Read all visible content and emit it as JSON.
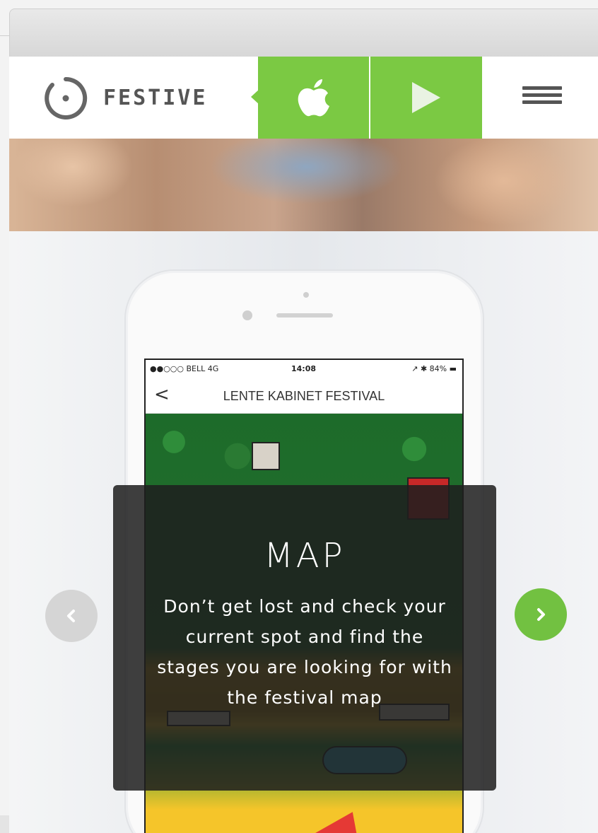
{
  "header": {
    "brand": "FESTIVE",
    "app_store_label": "apple-logo",
    "play_store_label": "play-triangle",
    "menu_icon": "hamburger-menu-icon"
  },
  "phone": {
    "status": {
      "carrier": "●●○○○ BELL  4G",
      "time": "14:08",
      "indicators": "↗ ✱ 84% ▬"
    },
    "nav": {
      "back": "<",
      "title": "LENTE KABINET FESTIVAL"
    }
  },
  "slide": {
    "title": "MAP",
    "description": "Don’t get lost and check your current spot and find the stages you are looking for with the festival map"
  },
  "carousel": {
    "prev_icon": "chevron-left-icon",
    "next_icon": "chevron-right-icon"
  },
  "colors": {
    "accent_green": "#7bc943",
    "next_button": "#72c141",
    "prev_button": "#d5d5d5",
    "text_dark": "#555555"
  }
}
